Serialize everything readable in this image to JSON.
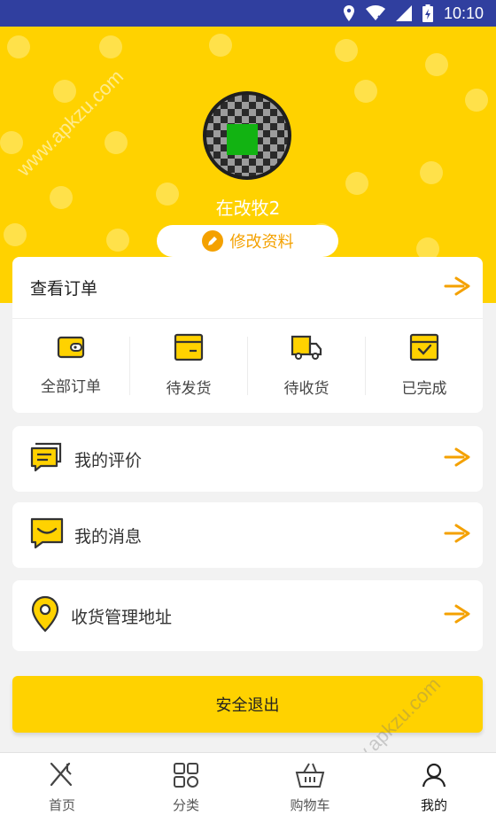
{
  "status_bar": {
    "time": "10:10",
    "icons": [
      "location-icon",
      "wifi-icon",
      "signal-icon",
      "battery-icon"
    ]
  },
  "profile": {
    "username": "在改牧2",
    "edit_label": "修改资料"
  },
  "orders": {
    "title": "查看订单",
    "items": [
      {
        "label": "全部订单",
        "icon": "wallet-icon"
      },
      {
        "label": "待发货",
        "icon": "box-icon"
      },
      {
        "label": "待收货",
        "icon": "truck-icon"
      },
      {
        "label": "已完成",
        "icon": "done-box-icon"
      }
    ]
  },
  "menu": [
    {
      "label": "我的评价",
      "icon": "review-icon"
    },
    {
      "label": "我的消息",
      "icon": "message-icon"
    },
    {
      "label": "收货管理地址",
      "icon": "location-pin-icon"
    }
  ],
  "logout_label": "安全退出",
  "tabs": [
    {
      "label": "首页",
      "icon": "home-utensils-icon",
      "active": false
    },
    {
      "label": "分类",
      "icon": "category-grid-icon",
      "active": false
    },
    {
      "label": "购物车",
      "icon": "cart-basket-icon",
      "active": false
    },
    {
      "label": "我的",
      "icon": "user-icon",
      "active": true
    }
  ],
  "watermark": "www.apkzu.com",
  "colors": {
    "accent_yellow": "#ffd200",
    "accent_orange": "#f4a100",
    "status_bar": "#303f9f"
  }
}
